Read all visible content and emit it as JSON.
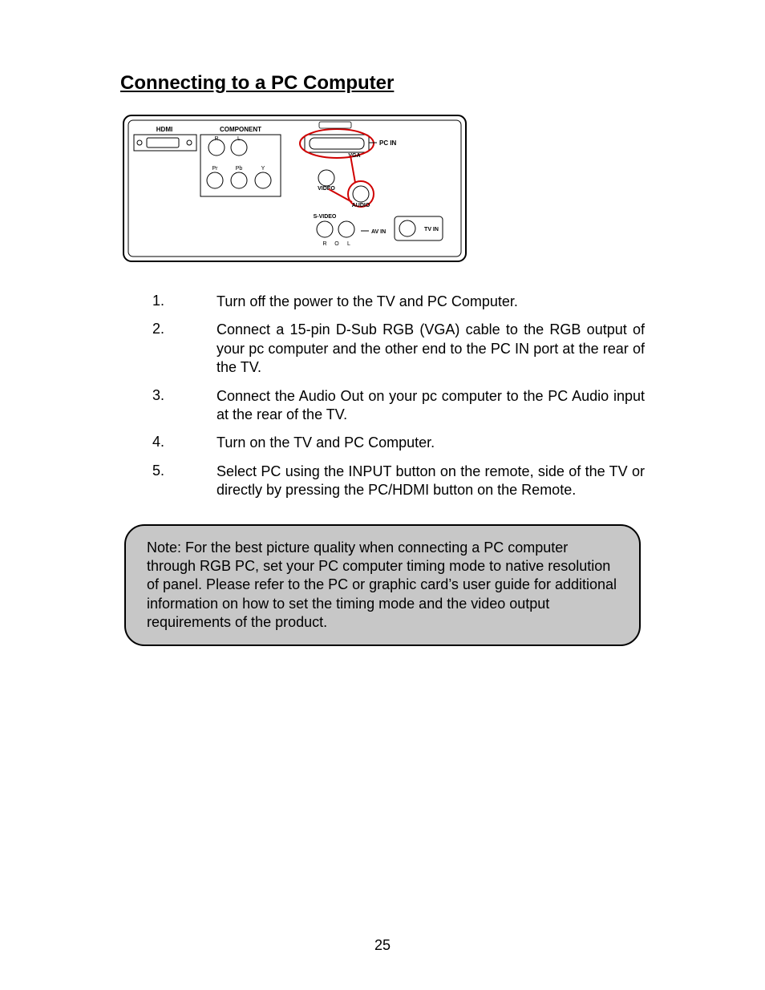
{
  "title": "Connecting to a PC Computer",
  "diagram": {
    "labels": {
      "hdmi": "HDMI",
      "component": "COMPONENT",
      "r": "R",
      "l": "L",
      "pr": "Pr",
      "pb": "Pb",
      "y": "Y",
      "pc_in": "PC IN",
      "vga": "VGA",
      "video": "VIDEO",
      "audio": "AUDIO",
      "s_video": "S-VIDEO",
      "av_in": "AV IN",
      "tv_in": "TV IN",
      "r2": "R",
      "o": "O",
      "l2": "L"
    }
  },
  "steps": [
    {
      "n": "1.",
      "t": "Turn off the power to the TV and PC Computer."
    },
    {
      "n": "2.",
      "t": "Connect a 15-pin D-Sub RGB (VGA) cable to the RGB output of your pc computer and the other end to the PC IN port at the rear of the TV."
    },
    {
      "n": "3.",
      "t": "Connect the Audio Out on your pc computer to the PC Audio input at the rear of the TV."
    },
    {
      "n": "4.",
      "t": "Turn on the TV and PC Computer."
    },
    {
      "n": "5.",
      "t": "Select PC using the INPUT button on the remote, side of the TV or directly by pressing the PC/HDMI button on the Remote."
    }
  ],
  "note": "Note: For the best picture quality when connecting a PC computer through RGB PC, set your PC computer timing mode to native resolution of panel. Please refer to the PC or graphic card’s user guide for additional information on how to set the timing mode and the video output requirements of the product.",
  "page_number": "25"
}
